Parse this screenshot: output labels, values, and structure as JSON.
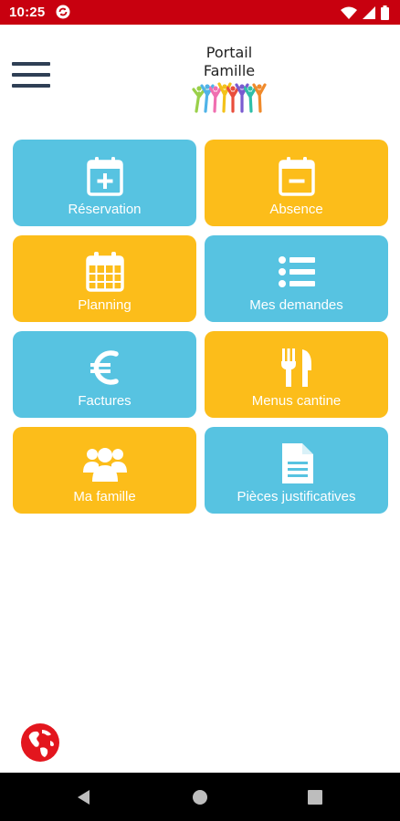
{
  "status_bar": {
    "time": "10:25"
  },
  "header": {
    "logo_line1": "Portail",
    "logo_line2": "Famille"
  },
  "tiles": [
    {
      "label": "Réservation",
      "icon": "calendar-plus-icon",
      "color": "#57c3e1"
    },
    {
      "label": "Absence",
      "icon": "calendar-minus-icon",
      "color": "#fcbd1a"
    },
    {
      "label": "Planning",
      "icon": "calendar-grid-icon",
      "color": "#fcbd1a"
    },
    {
      "label": "Mes demandes",
      "icon": "list-icon",
      "color": "#57c3e1"
    },
    {
      "label": "Factures",
      "icon": "euro-icon",
      "color": "#57c3e1"
    },
    {
      "label": "Menus cantine",
      "icon": "fork-knife-icon",
      "color": "#fcbd1a"
    },
    {
      "label": "Ma famille",
      "icon": "family-icon",
      "color": "#fcbd1a"
    },
    {
      "label": "Pièces justificatives",
      "icon": "document-icon",
      "color": "#57c3e1"
    }
  ],
  "colors": {
    "status_bar": "#c8000f",
    "tile_blue": "#57c3e1",
    "tile_yellow": "#fcbd1a",
    "menu_icon": "#2f3f55",
    "globe": "#e3161e"
  }
}
